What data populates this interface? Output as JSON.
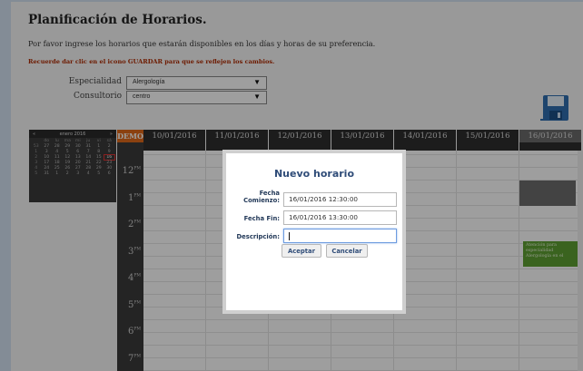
{
  "header": {
    "title": "Planificación de Horarios.",
    "intro": "Por favor ingrese los horarios que estarán disponibles en los días y horas de su preferencia.",
    "warning": "Recuerde dar clic en el icono GUARDAR para que se reflejen los cambios."
  },
  "filters": {
    "especialidad_label": "Especialidad",
    "especialidad_value": "Alergología",
    "consultorio_label": "Consultorio",
    "consultorio_value": "centro"
  },
  "mini_calendar": {
    "prev": "«",
    "month": "enero 2016",
    "next": "»",
    "day_names": [
      "do",
      "lu",
      "ma",
      "mi",
      "ju",
      "vi",
      "sá"
    ],
    "weeks": [
      [
        "53",
        "27",
        "28",
        "29",
        "30",
        "31",
        "1",
        "2"
      ],
      [
        "1",
        "3",
        "4",
        "5",
        "6",
        "7",
        "8",
        "9"
      ],
      [
        "2",
        "10",
        "11",
        "12",
        "13",
        "14",
        "15",
        "16"
      ],
      [
        "3",
        "17",
        "18",
        "19",
        "20",
        "21",
        "22",
        "23"
      ],
      [
        "4",
        "24",
        "25",
        "26",
        "27",
        "28",
        "29",
        "30"
      ],
      [
        "5",
        "31",
        "1",
        "2",
        "3",
        "4",
        "5",
        "6"
      ]
    ]
  },
  "calendar": {
    "demo_label": "DEMO",
    "days": [
      "10/01/2016",
      "11/01/2016",
      "12/01/2016",
      "13/01/2016",
      "14/01/2016",
      "15/01/2016",
      "16/01/2016"
    ],
    "hours": [
      {
        "h": "12",
        "s": "PM"
      },
      {
        "h": "1",
        "s": "PM"
      },
      {
        "h": "2",
        "s": "PM"
      },
      {
        "h": "3",
        "s": "PM"
      },
      {
        "h": "4",
        "s": "PM"
      },
      {
        "h": "5",
        "s": "PM"
      },
      {
        "h": "6",
        "s": "PM"
      },
      {
        "h": "7",
        "s": "PM"
      }
    ],
    "event_text": "Atención para especialidad Alergología en el"
  },
  "dialog": {
    "title": "Nuevo horario",
    "start_label_1": "Fecha",
    "start_label_2": "Comienzo:",
    "start_value": "16/01/2016 12:30:00",
    "end_label": "Fecha Fin:",
    "end_value": "16/01/2016 13:30:00",
    "desc_label": "Descripción:",
    "desc_value": "",
    "accept": "Aceptar",
    "cancel": "Cancelar"
  },
  "icons": {
    "save": "floppy-disk-icon",
    "dropdown": "dropdown-arrow-icon"
  }
}
